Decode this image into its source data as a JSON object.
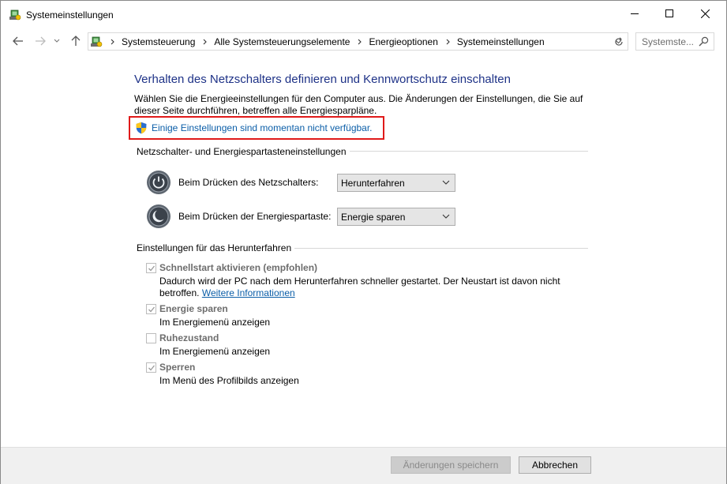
{
  "window": {
    "title": "Systemeinstellungen"
  },
  "address": {
    "crumbs": [
      "Systemsteuerung",
      "Alle Systemsteuerungselemente",
      "Energieoptionen",
      "Systemeinstellungen"
    ],
    "search_placeholder": "Systemste..."
  },
  "content": {
    "heading": "Verhalten des Netzschalters definieren und Kennwortschutz einschalten",
    "intro": "Wählen Sie die Energieeinstellungen für den Computer aus. Die Änderungen der Einstellungen, die Sie auf dieser Seite durchführen, betreffen alle Energiesparpläne.",
    "unavailable_link": "Einige Einstellungen sind momentan nicht verfügbar."
  },
  "power_section": {
    "title": "Netzschalter- und Energiespartasteneinstellungen",
    "power_button_label": "Beim Drücken des Netzschalters:",
    "power_button_value": "Herunterfahren",
    "sleep_button_label": "Beim Drücken der Energiespartaste:",
    "sleep_button_value": "Energie sparen"
  },
  "shutdown_section": {
    "title": "Einstellungen für das Herunterfahren",
    "items": [
      {
        "label": "Schnellstart aktivieren (empfohlen)",
        "checked": true,
        "desc": "Dadurch wird der PC nach dem Herunterfahren schneller gestartet. Der Neustart ist davon nicht betroffen.",
        "link": "Weitere Informationen"
      },
      {
        "label": "Energie sparen",
        "checked": true,
        "desc": "Im Energiemenü anzeigen"
      },
      {
        "label": "Ruhezustand",
        "checked": false,
        "desc": "Im Energiemenü anzeigen"
      },
      {
        "label": "Sperren",
        "checked": true,
        "desc": "Im Menü des Profilbilds anzeigen"
      }
    ]
  },
  "footer": {
    "save_label": "Änderungen speichern",
    "cancel_label": "Abbrechen"
  },
  "colors": {
    "heading": "#1e3287",
    "link": "#0b5ea8",
    "highlight_border": "#e01a1a"
  }
}
